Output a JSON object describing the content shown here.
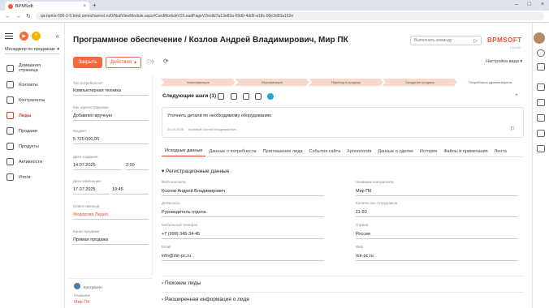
{
  "browser": {
    "tab_title": "BPMSoft",
    "tab_close": "×",
    "new_tab": "+",
    "url": "qa-bpms-036-2-5.bmd.omnichannel.ru/0/Nui/ViewModule.aspx#CardModuleV2/LeadPageV2/edit/7a13e83a-69d9-4dd5-a18c-00e3d93a162e",
    "window_controls": [
      "–",
      "□",
      "×"
    ],
    "nav": [
      "←",
      "→",
      "↻"
    ]
  },
  "sidebar": {
    "workspace": "Менеджер по продажам",
    "items": [
      {
        "label": "Домашняя страница"
      },
      {
        "label": "Контакты"
      },
      {
        "label": "Контрагенты"
      },
      {
        "label": "Лиды"
      },
      {
        "label": "Продажи"
      },
      {
        "label": "Продукты"
      },
      {
        "label": "Активности"
      },
      {
        "label": "Итоги"
      }
    ],
    "active": "Лиды"
  },
  "header": {
    "title": "Программное обеспечение / Козлов Андрей Владимирович, Мир ПК",
    "command_placeholder": "Выполнить команду",
    "logo": "BPMSOFT",
    "logo_sub": "1.8.0.60",
    "close_label": "Закрыть",
    "actions_label": "Действия",
    "help_label": "?",
    "view_settings": "Настройка вида"
  },
  "form": {
    "need_type_label": "Тип потребности*",
    "need_type_value": "Компьютерная техника",
    "registration_method_label": "Как зарегистрирован",
    "registration_method_value": "Добавлен вручную",
    "budget_label": "Бюджет",
    "budget_value": "5 720 000,00",
    "created_label": "Дата создания",
    "created_date": "14.07.2025",
    "created_time": "2:00",
    "modified_label": "Дата изменения",
    "modified_date": "17.07.2025",
    "modified_time": "19:45",
    "owner_label": "Ответственный",
    "owner_value": "Федорова Лидия",
    "sales_channel_label": "Канал продажи",
    "sales_channel_value": "Прямая продажа",
    "contact_card_label": "Контрагент",
    "contact_name_label": "Название",
    "contact_name_value": "Мир ПК"
  },
  "stages": [
    "Квалификация",
    "Верификация",
    "Перевод в продажу",
    "Ожидание продажи",
    "Потребность удовлетворена"
  ],
  "next_steps": {
    "title": "Следующие шаги (1)",
    "task": "Уточнить детали по необходимому оборудованию",
    "date": "24.03.2025",
    "user": "Кочевый Сергей Владимирович"
  },
  "tabs": [
    "Исходные данные",
    "Данные о потребности",
    "Приглашение лида",
    "События сайта",
    "Хронология",
    "Данные о сделке",
    "История",
    "Файлы и примечания",
    "Лента"
  ],
  "registration": {
    "heading": "Регистрационные данные",
    "fields_left": [
      {
        "label": "ФИО контакта",
        "value": "Козлов Андрей Владимирович"
      },
      {
        "label": "Должность",
        "value": "Руководитель отдела"
      },
      {
        "label": "Мобильный телефон",
        "value": "+7 (999) 345-34-45"
      },
      {
        "label": "Email",
        "value": "info@mir-pc.ru"
      }
    ],
    "fields_right": [
      {
        "label": "Название контрагента",
        "value": "Мир ПК"
      },
      {
        "label": "Количество сотрудников",
        "value": "11-20"
      },
      {
        "label": "Страна",
        "value": "Россия"
      },
      {
        "label": "Web",
        "value": "mir-pc.ru"
      }
    ]
  },
  "sections": {
    "similar": "Похожие лиды",
    "extended": "Расширенная информация о лиде"
  }
}
